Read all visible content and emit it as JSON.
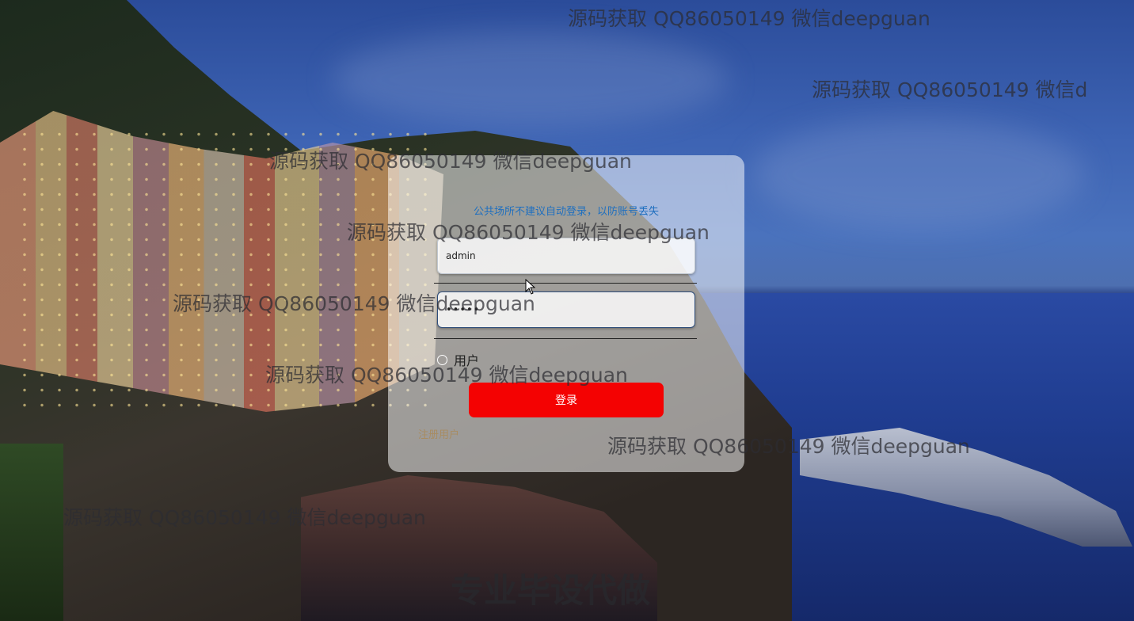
{
  "login": {
    "notice": "公共场所不建议自动登录，以防账号丢失",
    "username_value": "admin",
    "password_value": "•••••",
    "role_label": "用户",
    "login_button": "登录",
    "register_link": "注册用户"
  },
  "watermarks": {
    "line": "源码获取 QQ86050149 微信deepguan",
    "line_cut": "源码获取 QQ86050149 微信d",
    "footer": "专业毕设代做"
  },
  "colors": {
    "login_button": "#f40202",
    "notice_text": "#1f6fbf",
    "register_text": "#a88c61"
  }
}
